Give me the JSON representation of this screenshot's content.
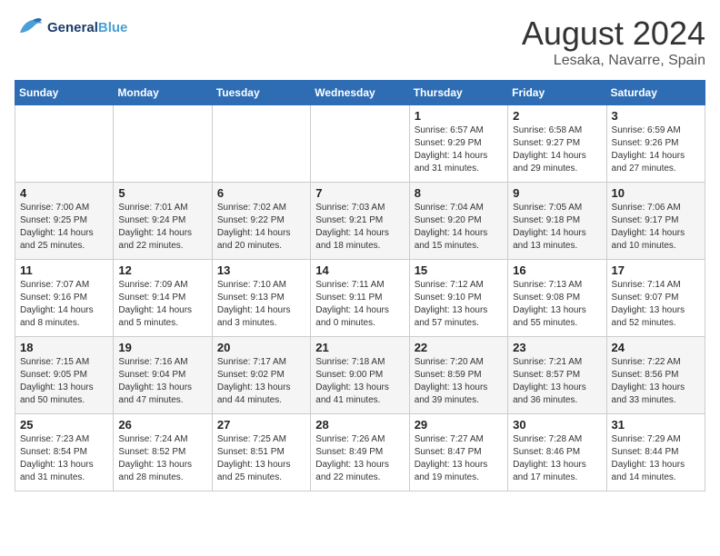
{
  "header": {
    "logo_line1": "General",
    "logo_line2": "Blue",
    "main_title": "August 2024",
    "subtitle": "Lesaka, Navarre, Spain"
  },
  "weekdays": [
    "Sunday",
    "Monday",
    "Tuesday",
    "Wednesday",
    "Thursday",
    "Friday",
    "Saturday"
  ],
  "weeks": [
    [
      {
        "day": "",
        "info": ""
      },
      {
        "day": "",
        "info": ""
      },
      {
        "day": "",
        "info": ""
      },
      {
        "day": "",
        "info": ""
      },
      {
        "day": "1",
        "info": "Sunrise: 6:57 AM\nSunset: 9:29 PM\nDaylight: 14 hours\nand 31 minutes."
      },
      {
        "day": "2",
        "info": "Sunrise: 6:58 AM\nSunset: 9:27 PM\nDaylight: 14 hours\nand 29 minutes."
      },
      {
        "day": "3",
        "info": "Sunrise: 6:59 AM\nSunset: 9:26 PM\nDaylight: 14 hours\nand 27 minutes."
      }
    ],
    [
      {
        "day": "4",
        "info": "Sunrise: 7:00 AM\nSunset: 9:25 PM\nDaylight: 14 hours\nand 25 minutes."
      },
      {
        "day": "5",
        "info": "Sunrise: 7:01 AM\nSunset: 9:24 PM\nDaylight: 14 hours\nand 22 minutes."
      },
      {
        "day": "6",
        "info": "Sunrise: 7:02 AM\nSunset: 9:22 PM\nDaylight: 14 hours\nand 20 minutes."
      },
      {
        "day": "7",
        "info": "Sunrise: 7:03 AM\nSunset: 9:21 PM\nDaylight: 14 hours\nand 18 minutes."
      },
      {
        "day": "8",
        "info": "Sunrise: 7:04 AM\nSunset: 9:20 PM\nDaylight: 14 hours\nand 15 minutes."
      },
      {
        "day": "9",
        "info": "Sunrise: 7:05 AM\nSunset: 9:18 PM\nDaylight: 14 hours\nand 13 minutes."
      },
      {
        "day": "10",
        "info": "Sunrise: 7:06 AM\nSunset: 9:17 PM\nDaylight: 14 hours\nand 10 minutes."
      }
    ],
    [
      {
        "day": "11",
        "info": "Sunrise: 7:07 AM\nSunset: 9:16 PM\nDaylight: 14 hours\nand 8 minutes."
      },
      {
        "day": "12",
        "info": "Sunrise: 7:09 AM\nSunset: 9:14 PM\nDaylight: 14 hours\nand 5 minutes."
      },
      {
        "day": "13",
        "info": "Sunrise: 7:10 AM\nSunset: 9:13 PM\nDaylight: 14 hours\nand 3 minutes."
      },
      {
        "day": "14",
        "info": "Sunrise: 7:11 AM\nSunset: 9:11 PM\nDaylight: 14 hours\nand 0 minutes."
      },
      {
        "day": "15",
        "info": "Sunrise: 7:12 AM\nSunset: 9:10 PM\nDaylight: 13 hours\nand 57 minutes."
      },
      {
        "day": "16",
        "info": "Sunrise: 7:13 AM\nSunset: 9:08 PM\nDaylight: 13 hours\nand 55 minutes."
      },
      {
        "day": "17",
        "info": "Sunrise: 7:14 AM\nSunset: 9:07 PM\nDaylight: 13 hours\nand 52 minutes."
      }
    ],
    [
      {
        "day": "18",
        "info": "Sunrise: 7:15 AM\nSunset: 9:05 PM\nDaylight: 13 hours\nand 50 minutes."
      },
      {
        "day": "19",
        "info": "Sunrise: 7:16 AM\nSunset: 9:04 PM\nDaylight: 13 hours\nand 47 minutes."
      },
      {
        "day": "20",
        "info": "Sunrise: 7:17 AM\nSunset: 9:02 PM\nDaylight: 13 hours\nand 44 minutes."
      },
      {
        "day": "21",
        "info": "Sunrise: 7:18 AM\nSunset: 9:00 PM\nDaylight: 13 hours\nand 41 minutes."
      },
      {
        "day": "22",
        "info": "Sunrise: 7:20 AM\nSunset: 8:59 PM\nDaylight: 13 hours\nand 39 minutes."
      },
      {
        "day": "23",
        "info": "Sunrise: 7:21 AM\nSunset: 8:57 PM\nDaylight: 13 hours\nand 36 minutes."
      },
      {
        "day": "24",
        "info": "Sunrise: 7:22 AM\nSunset: 8:56 PM\nDaylight: 13 hours\nand 33 minutes."
      }
    ],
    [
      {
        "day": "25",
        "info": "Sunrise: 7:23 AM\nSunset: 8:54 PM\nDaylight: 13 hours\nand 31 minutes."
      },
      {
        "day": "26",
        "info": "Sunrise: 7:24 AM\nSunset: 8:52 PM\nDaylight: 13 hours\nand 28 minutes."
      },
      {
        "day": "27",
        "info": "Sunrise: 7:25 AM\nSunset: 8:51 PM\nDaylight: 13 hours\nand 25 minutes."
      },
      {
        "day": "28",
        "info": "Sunrise: 7:26 AM\nSunset: 8:49 PM\nDaylight: 13 hours\nand 22 minutes."
      },
      {
        "day": "29",
        "info": "Sunrise: 7:27 AM\nSunset: 8:47 PM\nDaylight: 13 hours\nand 19 minutes."
      },
      {
        "day": "30",
        "info": "Sunrise: 7:28 AM\nSunset: 8:46 PM\nDaylight: 13 hours\nand 17 minutes."
      },
      {
        "day": "31",
        "info": "Sunrise: 7:29 AM\nSunset: 8:44 PM\nDaylight: 13 hours\nand 14 minutes."
      }
    ]
  ]
}
